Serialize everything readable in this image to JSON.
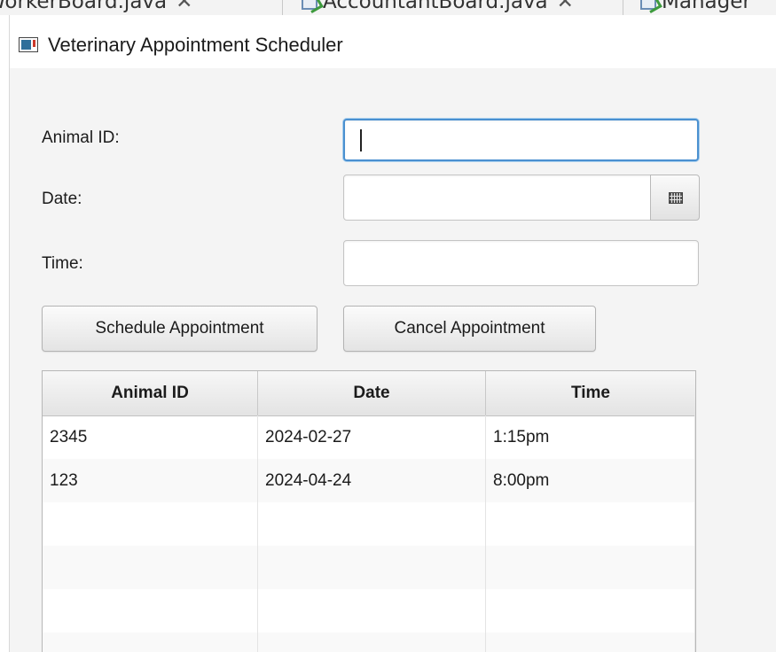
{
  "editor_tabs": [
    {
      "label": "WorkerBoard.java",
      "close": "✕"
    },
    {
      "label": "AccountantBoard.java",
      "close": "✕"
    },
    {
      "label": "Manager"
    }
  ],
  "window": {
    "title": "Veterinary Appointment Scheduler",
    "icon": "app-window-icon"
  },
  "form": {
    "animal_id_label": "Animal ID:",
    "animal_id_value": "",
    "date_label": "Date:",
    "date_value": "",
    "date_picker_icon": "calendar-icon",
    "time_label": "Time:",
    "time_value": ""
  },
  "buttons": {
    "schedule": "Schedule Appointment",
    "cancel": "Cancel Appointment"
  },
  "table": {
    "columns": [
      "Animal ID",
      "Date",
      "Time"
    ],
    "rows": [
      [
        "2345",
        "2024-02-27",
        "1:15pm"
      ],
      [
        "123",
        "2024-04-24",
        "8:00pm"
      ]
    ]
  },
  "colors": {
    "focus_border": "#4a90d0",
    "window_background": "#f4f4f4"
  }
}
